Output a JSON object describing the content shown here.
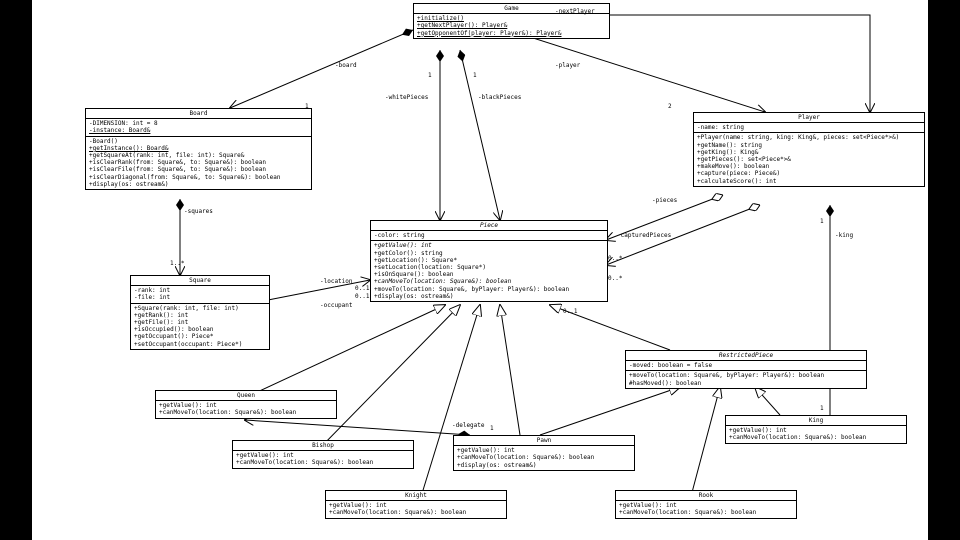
{
  "diagram_type": "UML class diagram",
  "classes": {
    "Game": {
      "name": "Game",
      "ops": [
        "+initialize()",
        "+getNextPlayer(): Player&",
        "+getOpponentOf(player: Player&): Player&"
      ],
      "ops_underline": true
    },
    "Board": {
      "name": "Board",
      "attrs": [
        "-DIMENSION: int = 8",
        "-instance: Board&"
      ],
      "attrs_underline": [
        false,
        true
      ],
      "ops": [
        "-Board()",
        "+getInstance(): Board&",
        "+getSquareAt(rank: int, file: int): Square&",
        "+isClearRank(from: Square&, to: Square&): boolean",
        "+isClearFile(from: Square&, to: Square&): boolean",
        "+isClearDiagonal(from: Square&, to: Square&): boolean",
        "+display(os: ostream&)"
      ],
      "ops_underline_idx": 1
    },
    "Square": {
      "name": "Square",
      "attrs": [
        "-rank: int",
        "-file: int"
      ],
      "ops": [
        "+Square(rank: int, file: int)",
        "+getRank(): int",
        "+getFile(): int",
        "+isOccupied(): boolean",
        "+getOccupant(): Piece*",
        "+setOccupant(occupant: Piece*)"
      ]
    },
    "Piece": {
      "name": "Piece",
      "italic": true,
      "attrs": [
        "-color: string"
      ],
      "ops": [
        "+getValue(): int",
        "+getColor(): string",
        "+getLocation(): Square*",
        "+setLocation(location: Square*)",
        "+isOnSquare(): boolean",
        "+canMoveTo(location: Square&): boolean",
        "+moveTo(location: Square&, byPlayer: Player&): boolean",
        "+display(os: ostream&)"
      ],
      "ops_italic_idx": [
        0,
        5
      ]
    },
    "Player": {
      "name": "Player",
      "attrs": [
        "-name: string"
      ],
      "ops": [
        "+Player(name: string, king: King&, pieces: set<Piece*>&)",
        "+getName(): string",
        "+getKing(): King&",
        "+getPieces(): set<Piece*>&",
        "+makeMove(): boolean",
        "+capture(piece: Piece&)",
        "+calculateScore(): int"
      ]
    },
    "RestrictedPiece": {
      "name": "RestrictedPiece",
      "italic": true,
      "attrs": [
        "-moved: boolean = false"
      ],
      "ops": [
        "+moveTo(location: Square&, byPlayer: Player&): boolean",
        "#hasMoved(): boolean"
      ]
    },
    "Queen": {
      "name": "Queen",
      "ops": [
        "+getValue(): int",
        "+canMoveTo(location: Square&): boolean"
      ]
    },
    "Bishop": {
      "name": "Bishop",
      "ops": [
        "+getValue(): int",
        "+canMoveTo(location: Square&): boolean"
      ]
    },
    "Knight": {
      "name": "Knight",
      "ops": [
        "+getValue(): int",
        "+canMoveTo(location: Square&): boolean"
      ]
    },
    "Pawn": {
      "name": "Pawn",
      "ops": [
        "+getValue(): int",
        "+canMoveTo(location: Square&): boolean",
        "+display(os: ostream&)"
      ]
    },
    "Rook": {
      "name": "Rook",
      "ops": [
        "+getValue(): int",
        "+canMoveTo(location: Square&): boolean"
      ]
    },
    "King": {
      "name": "King",
      "ops": [
        "+getValue(): int",
        "+canMoveTo(location: Square&): boolean"
      ]
    }
  },
  "labels": {
    "board": "-board",
    "whitePieces": "-whitePieces",
    "blackPieces": "-blackPieces",
    "player": "-player",
    "nextPlayer": "-nextPlayer",
    "squares": "-squares",
    "location": "-location",
    "occupant": "-occupant",
    "pieces": "-pieces",
    "capturedPieces": "-capturedPieces",
    "king": "-king",
    "delegate": "-delegate",
    "one": "1",
    "two": "2",
    "oneStar": "1..*",
    "zeroOne": "0..1",
    "zeroStar": "0..*"
  }
}
